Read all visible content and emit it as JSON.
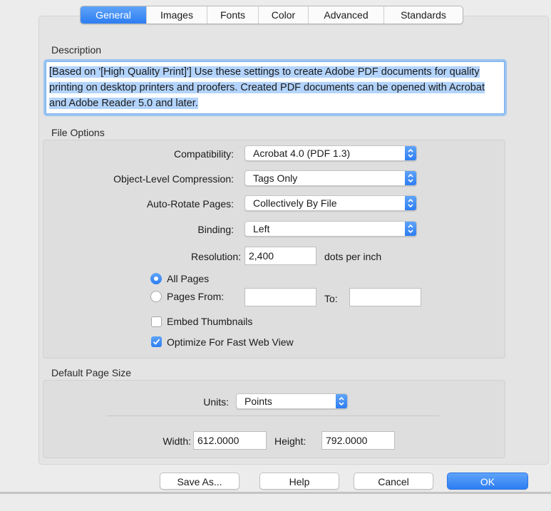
{
  "tabs": [
    {
      "label": "General",
      "active": true
    },
    {
      "label": "Images",
      "active": false
    },
    {
      "label": "Fonts",
      "active": false
    },
    {
      "label": "Color",
      "active": false
    },
    {
      "label": "Advanced",
      "active": false
    },
    {
      "label": "Standards",
      "active": false
    }
  ],
  "description": {
    "label": "Description",
    "text": "[Based on '[High Quality Print]'] Use these settings to create Adobe PDF documents for quality printing on desktop printers and proofers.  Created PDF documents can be opened with Acrobat and Adobe Reader 5.0 and later."
  },
  "file_options": {
    "label": "File Options",
    "compatibility": {
      "label": "Compatibility:",
      "value": "Acrobat 4.0 (PDF 1.3)"
    },
    "compression": {
      "label": "Object-Level Compression:",
      "value": "Tags Only"
    },
    "auto_rotate": {
      "label": "Auto-Rotate Pages:",
      "value": "Collectively By File"
    },
    "binding": {
      "label": "Binding:",
      "value": "Left"
    },
    "resolution": {
      "label": "Resolution:",
      "value": "2,400",
      "unit": "dots per inch"
    },
    "all_pages": {
      "label": "All Pages",
      "selected": true
    },
    "pages_from": {
      "label": "Pages From:",
      "selected": false,
      "from_value": "",
      "to_label": "To:",
      "to_value": ""
    },
    "embed_thumbnails": {
      "label": "Embed Thumbnails",
      "checked": false
    },
    "fast_web_view": {
      "label": "Optimize For Fast Web View",
      "checked": true
    }
  },
  "page_size": {
    "label": "Default Page Size",
    "units": {
      "label": "Units:",
      "value": "Points"
    },
    "width": {
      "label": "Width:",
      "value": "612.0000"
    },
    "height": {
      "label": "Height:",
      "value": "792.0000"
    }
  },
  "buttons": {
    "save_as": "Save As...",
    "help": "Help",
    "cancel": "Cancel",
    "ok": "OK"
  },
  "colors": {
    "accent": "#2d7df2",
    "selection": "#b3d4fc"
  },
  "icons": {
    "popup_arrows": "chevron-up-down-icon",
    "checkmark": "checkmark-icon"
  }
}
